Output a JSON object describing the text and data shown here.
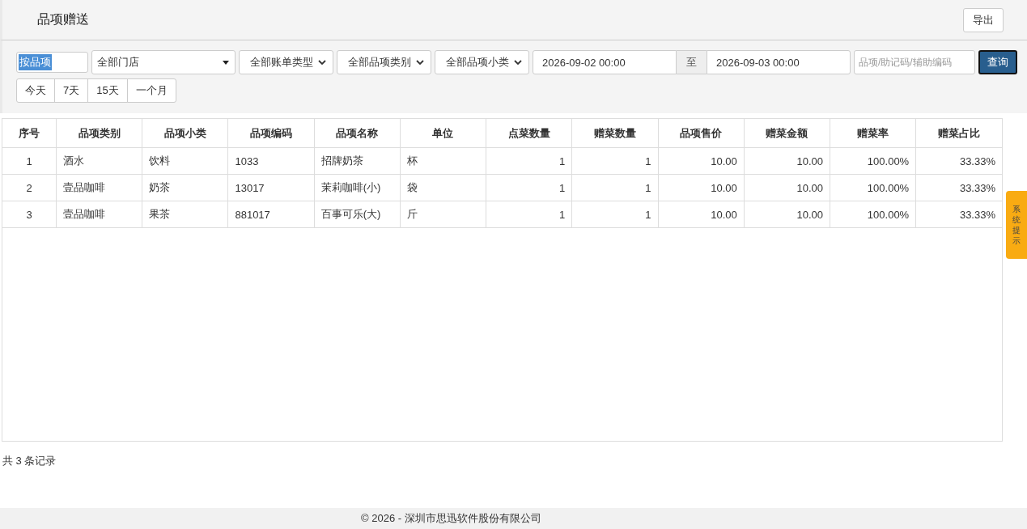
{
  "title": "品项赠送",
  "export_button": "导出",
  "filters": {
    "mode_switch": {
      "label": "按品项",
      "on": true
    },
    "store_select": "全部门店",
    "selects": [
      "全部账单类型",
      "全部品项类别",
      "全部品项小类"
    ],
    "date_from": "2026-09-02 00:00",
    "date_separator": "至",
    "date_to": "2026-09-03 00:00",
    "search": {
      "placeholder": "品项/助记码/辅助编码"
    },
    "query_button": "查询",
    "quick_ranges": [
      "今天",
      "7天",
      "15天",
      "一个月"
    ]
  },
  "table": {
    "columns": [
      "序号",
      "品项类别",
      "品项小类",
      "品项编码",
      "品项名称",
      "单位",
      "点菜数量",
      "赠菜数量",
      "品项售价",
      "赠菜金额",
      "赠菜率",
      "赠菜占比"
    ],
    "rows": [
      [
        "1",
        "酒水",
        "饮料",
        "1033",
        "招牌奶茶",
        "杯",
        "1",
        "1",
        "10.00",
        "10.00",
        "100.00%",
        "33.33%"
      ],
      [
        "2",
        "壹品咖啡",
        "奶茶",
        "13017",
        "茉莉咖啡(小)",
        "袋",
        "1",
        "1",
        "10.00",
        "10.00",
        "100.00%",
        "33.33%"
      ],
      [
        "3",
        "壹品咖啡",
        "果茶",
        "881017",
        "百事可乐(大)",
        "斤",
        "1",
        "1",
        "10.00",
        "10.00",
        "100.00%",
        "33.33%"
      ]
    ]
  },
  "record_count": "共 3 条记录",
  "side_tab": "系统提示",
  "footer": "© 2026 - 深圳市思迅软件股份有限公司"
}
